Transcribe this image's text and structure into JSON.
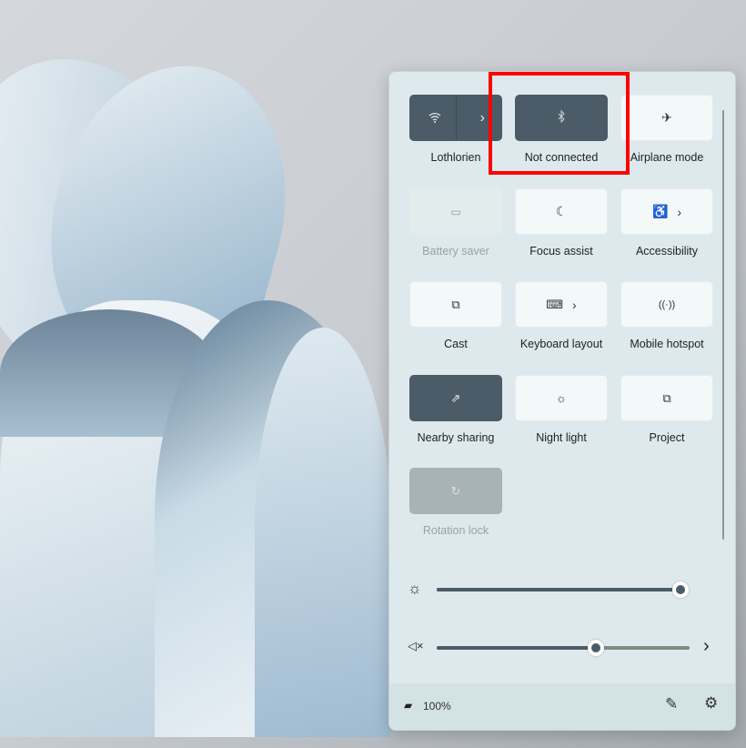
{
  "quick_settings": {
    "tiles": [
      {
        "label": "Lothlorien",
        "icon": "wifi-icon",
        "state": "on",
        "has_chevron": true
      },
      {
        "label": "Not connected",
        "icon": "bluetooth-icon",
        "state": "on"
      },
      {
        "label": "Airplane mode",
        "icon": "airplane-icon",
        "state": "off"
      },
      {
        "label": "Battery saver",
        "icon": "battery-saver-icon",
        "state": "disabled"
      },
      {
        "label": "Focus assist",
        "icon": "moon-icon",
        "state": "off"
      },
      {
        "label": "Accessibility",
        "icon": "accessibility-icon",
        "state": "off",
        "has_chevron": true
      },
      {
        "label": "Cast",
        "icon": "cast-icon",
        "state": "off"
      },
      {
        "label": "Keyboard layout",
        "icon": "keyboard-icon",
        "state": "off",
        "has_chevron": true
      },
      {
        "label": "Mobile hotspot",
        "icon": "hotspot-icon",
        "state": "off"
      },
      {
        "label": "Nearby sharing",
        "icon": "share-icon",
        "state": "on"
      },
      {
        "label": "Night light",
        "icon": "sun-icon",
        "state": "off"
      },
      {
        "label": "Project",
        "icon": "project-icon",
        "state": "off"
      },
      {
        "label": "Rotation lock",
        "icon": "rotation-lock-icon",
        "state": "disabled-on"
      }
    ],
    "brightness_percent": 100,
    "volume_percent": 63,
    "volume_muted": true
  },
  "footer": {
    "battery": "100%"
  },
  "accent": "#4b5b67",
  "highlight_color": "#ff0000"
}
